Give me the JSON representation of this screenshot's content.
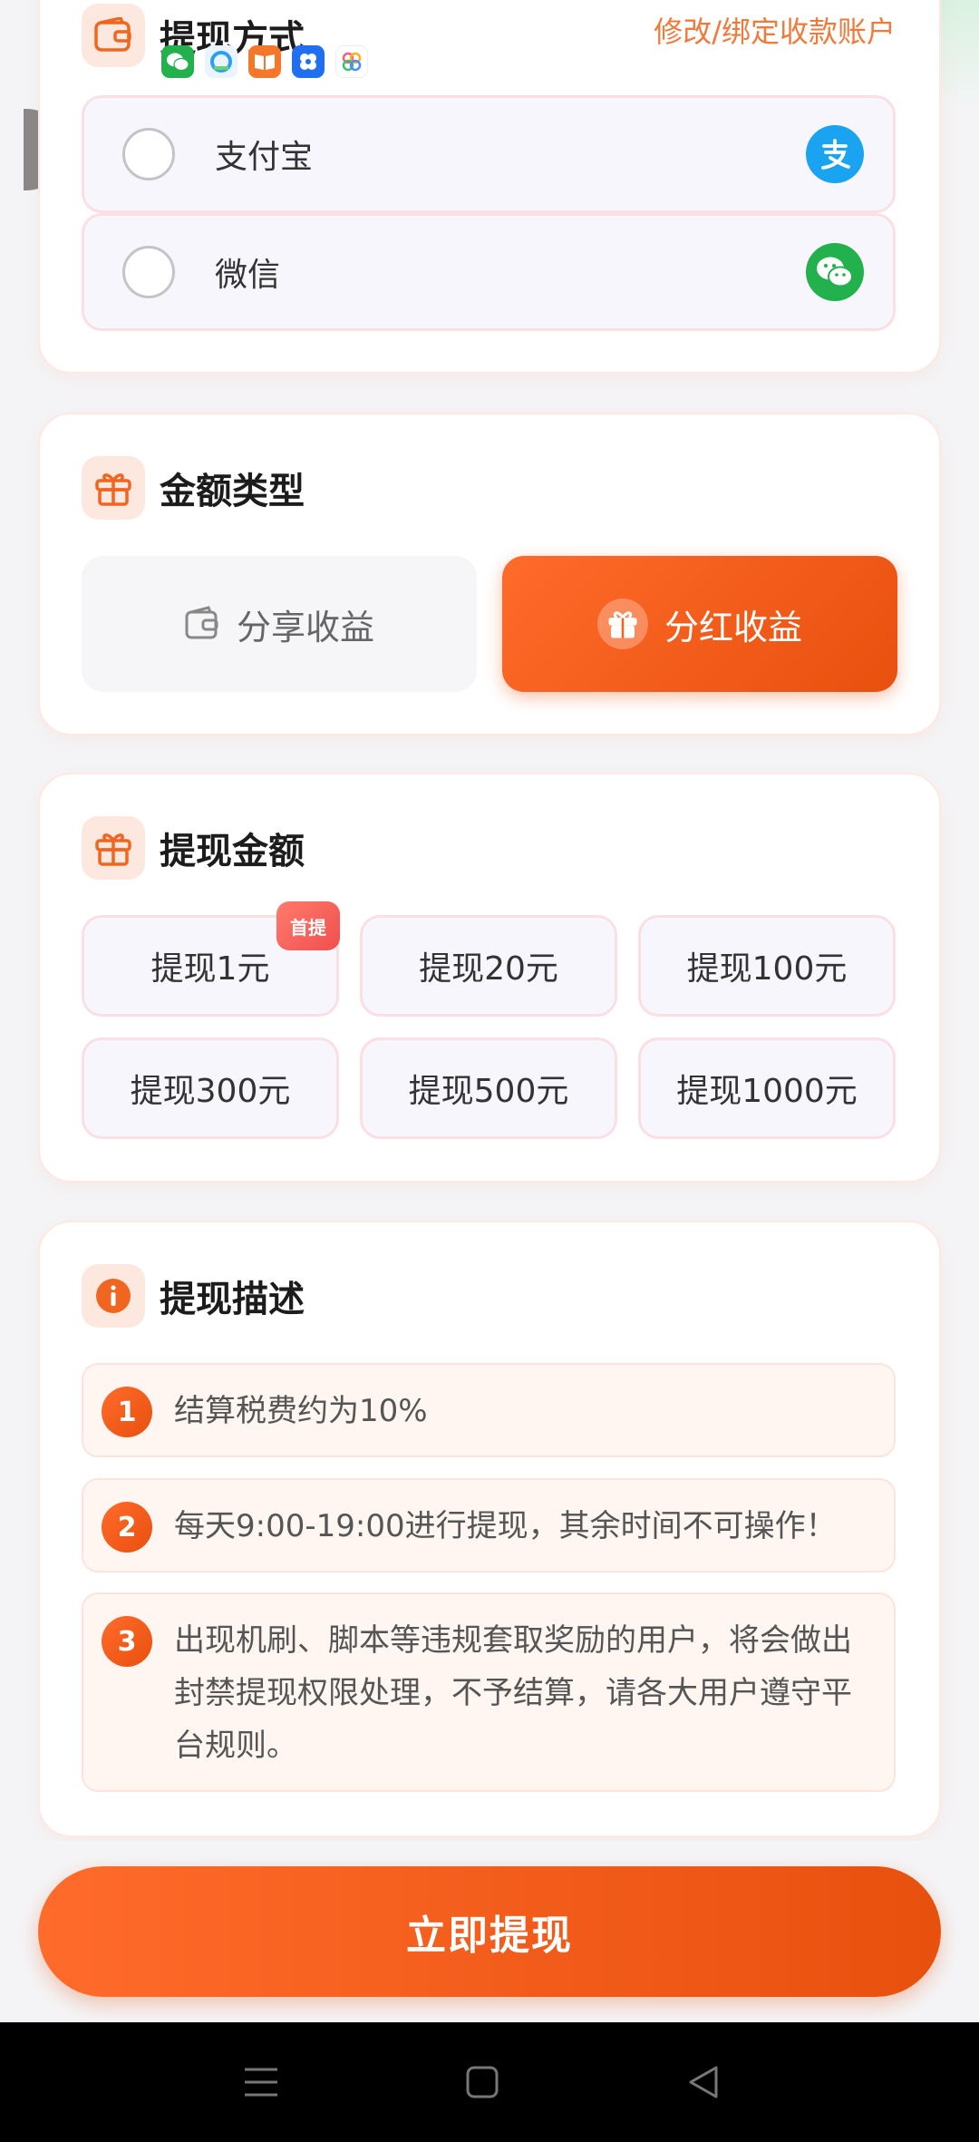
{
  "method": {
    "title": "提现方式",
    "edit_link": "修改/绑定收款账户",
    "options": [
      {
        "label": "支付宝",
        "logo_text": "支",
        "color": "#1aa3f0"
      },
      {
        "label": "微信",
        "color": "#22b14c"
      }
    ]
  },
  "amount_type": {
    "title": "金额类型",
    "options": [
      {
        "label": "分享收益",
        "selected": false
      },
      {
        "label": "分红收益",
        "selected": true
      }
    ]
  },
  "amount": {
    "title": "提现金额",
    "badge": "首提",
    "options": [
      {
        "label": "提现1元"
      },
      {
        "label": "提现20元"
      },
      {
        "label": "提现100元"
      },
      {
        "label": "提现300元"
      },
      {
        "label": "提现500元"
      },
      {
        "label": "提现1000元"
      }
    ]
  },
  "description": {
    "title": "提现描述",
    "items": [
      {
        "num": "1",
        "text": "结算税费约为10%"
      },
      {
        "num": "2",
        "text": "每天9:00-19:00进行提现，其余时间不可操作！"
      },
      {
        "num": "3",
        "text": "出现机刷、脚本等违规套取奖励的用户，将会做出封禁提现权限处理，不予结算，请各大用户遵守平台规则。"
      }
    ]
  },
  "submit_label": "立即提现",
  "colors": {
    "accent": "#f0651f",
    "accent_dark": "#e8500e"
  }
}
